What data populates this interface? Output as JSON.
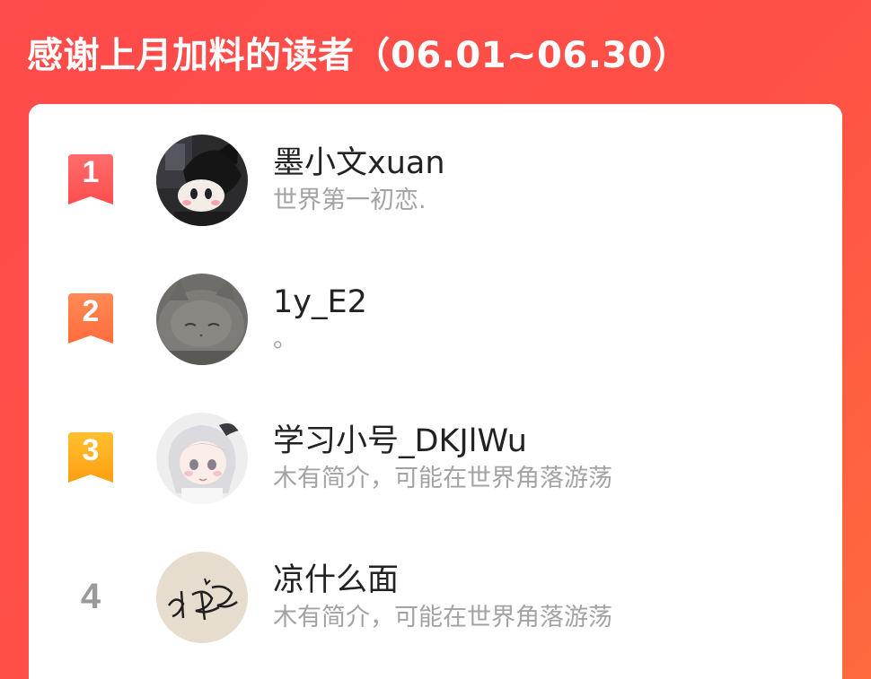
{
  "header": {
    "title": "感谢上月加料的读者（06.01~06.30）"
  },
  "colors": {
    "background": "#ff4b4b",
    "rank1": "#ff5a5a",
    "rank2": "#ff7a4a",
    "rank3": "#ffae1e",
    "rank_plain": "#9a9a9a"
  },
  "readers": [
    {
      "rank": "1",
      "name": "墨小文xuan",
      "bio": "世界第一初恋.",
      "avatar_icon": "kuromi-plush-avatar"
    },
    {
      "rank": "2",
      "name": "1y_E2",
      "bio": "。",
      "avatar_icon": "gray-cat-avatar"
    },
    {
      "rank": "3",
      "name": "学习小号_DKJlWu",
      "bio": "木有简介，可能在世界角落游荡",
      "avatar_icon": "anime-girl-avatar"
    },
    {
      "rank": "4",
      "name": "凉什么面",
      "bio": "木有简介，可能在世界角落游荡",
      "avatar_icon": "handwritten-signature-avatar"
    }
  ]
}
